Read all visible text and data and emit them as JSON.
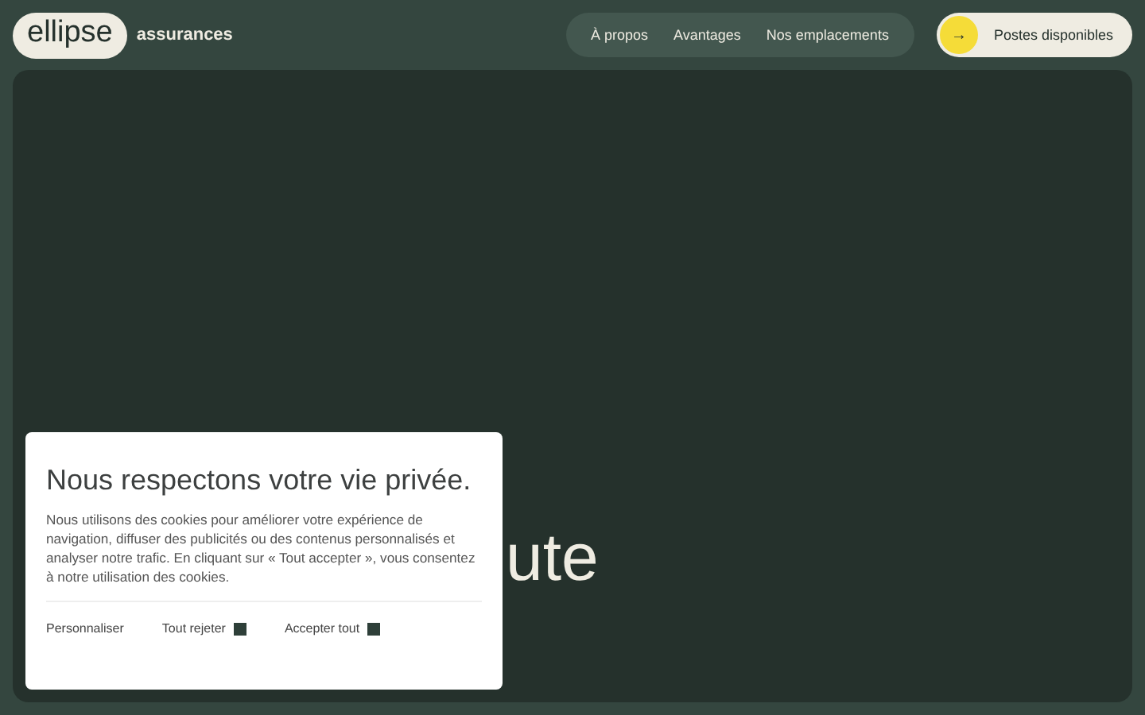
{
  "header": {
    "logo": "ellipse",
    "tagline": "assurances",
    "nav": [
      {
        "label": "À propos"
      },
      {
        "label": "Avantages"
      },
      {
        "label": "Nos emplacements"
      }
    ],
    "cta": {
      "icon": "→",
      "label": "Postes disponibles"
    }
  },
  "hero": {
    "heading": "ute"
  },
  "cookie_dialog": {
    "title": "Nous respectons votre vie privée.",
    "text": "Nous utilisons des cookies pour améliorer votre expérience de navigation, diffuser des publicités ou des contenus personnalisés et analyser notre trafic. En cliquant sur « Tout accepter », vous consentez à notre utilisation des cookies.",
    "buttons": [
      {
        "label": "Personnaliser",
        "kind": "plain"
      },
      {
        "label": "Tout rejeter",
        "kind": "square"
      },
      {
        "label": "Accepter tout",
        "kind": "square"
      }
    ]
  }
}
